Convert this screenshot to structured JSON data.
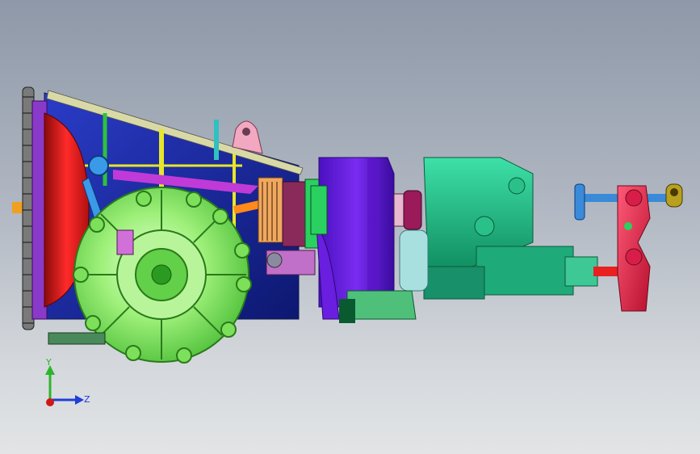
{
  "viewport": {
    "background_top": "#8e98a8",
    "background_bottom": "#e2e4e6"
  },
  "triad": {
    "y_label": "Y",
    "z_label": "Z",
    "y_color": "#2db52d",
    "z_color": "#1f3fd6",
    "x_color": "#d01818"
  },
  "part_colors": {
    "flywheel": "#e01818",
    "housing": "#1a2aa0",
    "flange": "#7de05a",
    "gear_case": "#6a1ee0",
    "transfer_case": "#1faa7a",
    "shift_bracket": "#d81e48",
    "shift_rod": "#3a8ad8"
  }
}
